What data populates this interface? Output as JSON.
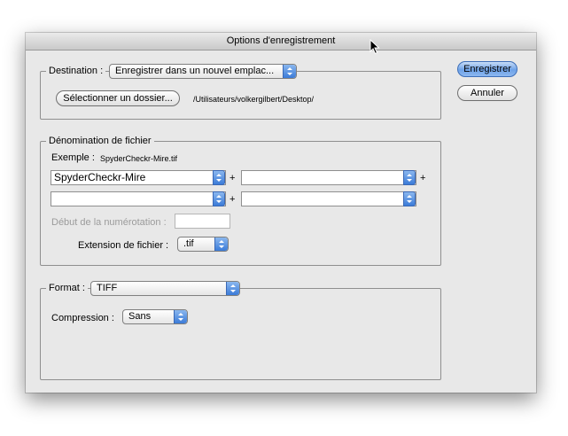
{
  "window": {
    "title": "Options d'enregistrement"
  },
  "destination": {
    "legend": "Destination :",
    "popup_value": "Enregistrer dans un nouvel emplac...",
    "select_folder_button": "Sélectionner un dossier...",
    "path": "/Utilisateurs/volkergilbert/Desktop/"
  },
  "naming": {
    "legend": "Dénomination de fichier",
    "example_label": "Exemple :",
    "example_value": "SpyderCheckr-Mire.tif",
    "field1_value": "SpyderCheckr-Mire",
    "field2_value": "",
    "field3_value": "",
    "field4_value": "",
    "plus": "+",
    "start_numbering_label": "Début de la numérotation :",
    "start_numbering_value": "",
    "extension_label": "Extension de fichier :",
    "extension_value": ".tif"
  },
  "format": {
    "legend": "Format :",
    "popup_value": "TIFF",
    "compression_label": "Compression :",
    "compression_value": "Sans"
  },
  "buttons": {
    "save": "Enregistrer",
    "cancel": "Annuler"
  },
  "colors": {
    "accent_blue": "#3b7bd8",
    "window_bg": "#e8e8e8"
  },
  "icons": {
    "popup_arrows": "up-down-arrows-icon",
    "cursor": "mouse-cursor-icon"
  }
}
